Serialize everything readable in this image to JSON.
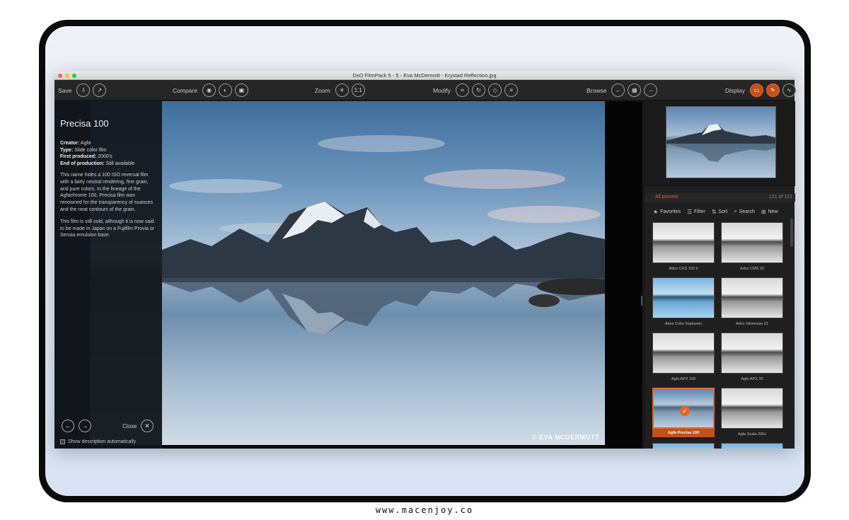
{
  "footer": {
    "url": "www.macenjoy.co"
  },
  "window": {
    "title": "DxO FilmPack 5 - 5 - Eva McDermott - Krystad Reflection.jpg"
  },
  "toolbar": {
    "save_label": "Save",
    "compare_label": "Compare",
    "zoom_label": "Zoom",
    "zoom_fit": "1:1",
    "modify_label": "Modify",
    "browse_label": "Browse",
    "display_label": "Display"
  },
  "info_panel": {
    "title": "Precisa 100",
    "creator_label": "Creator:",
    "creator": " Agfa",
    "type_label": "Type:",
    "type": " Slide color film",
    "first_produced_label": "First produced:",
    "first_produced": " 2000's",
    "end_label": "End of production:",
    "end": " Still available",
    "paragraph1": "This name hides a 100 ISO reversal film with a fairly neutral rendering, fine grain, and pure colors. In the lineage of the Agfachrome 100, Precisa film was renowned for the transparency of nuances and the neat contours of the grain.",
    "paragraph2": "This film is still sold, although it is now said to be made in Japan on a Fujifilm Provia or Sensia emulsion base.",
    "close_label": "Close",
    "show_desc_label": "Show description automatically"
  },
  "photo": {
    "watermark": "© EVA MCDERMOTT"
  },
  "presets": {
    "title": "All presets",
    "count": "121 of 121",
    "tools": {
      "favorites": "Favorites",
      "filter": "Filter",
      "sort": "Sort",
      "search": "Search",
      "new": "New"
    },
    "items": [
      {
        "label": "Adox CHS 100 II"
      },
      {
        "label": "Adox CMS 20"
      },
      {
        "label": "Adox Color Implosion"
      },
      {
        "label": "Adox Silvermax 21"
      },
      {
        "label": "Agfa APX 100"
      },
      {
        "label": "Agfa APX 25"
      },
      {
        "label": "Agfa Precisa 100"
      },
      {
        "label": "Agfa Scala 200x"
      }
    ]
  },
  "colors": {
    "accent": "#e0662c",
    "toolbar": "#262626",
    "panel": "#1f1f1f"
  }
}
